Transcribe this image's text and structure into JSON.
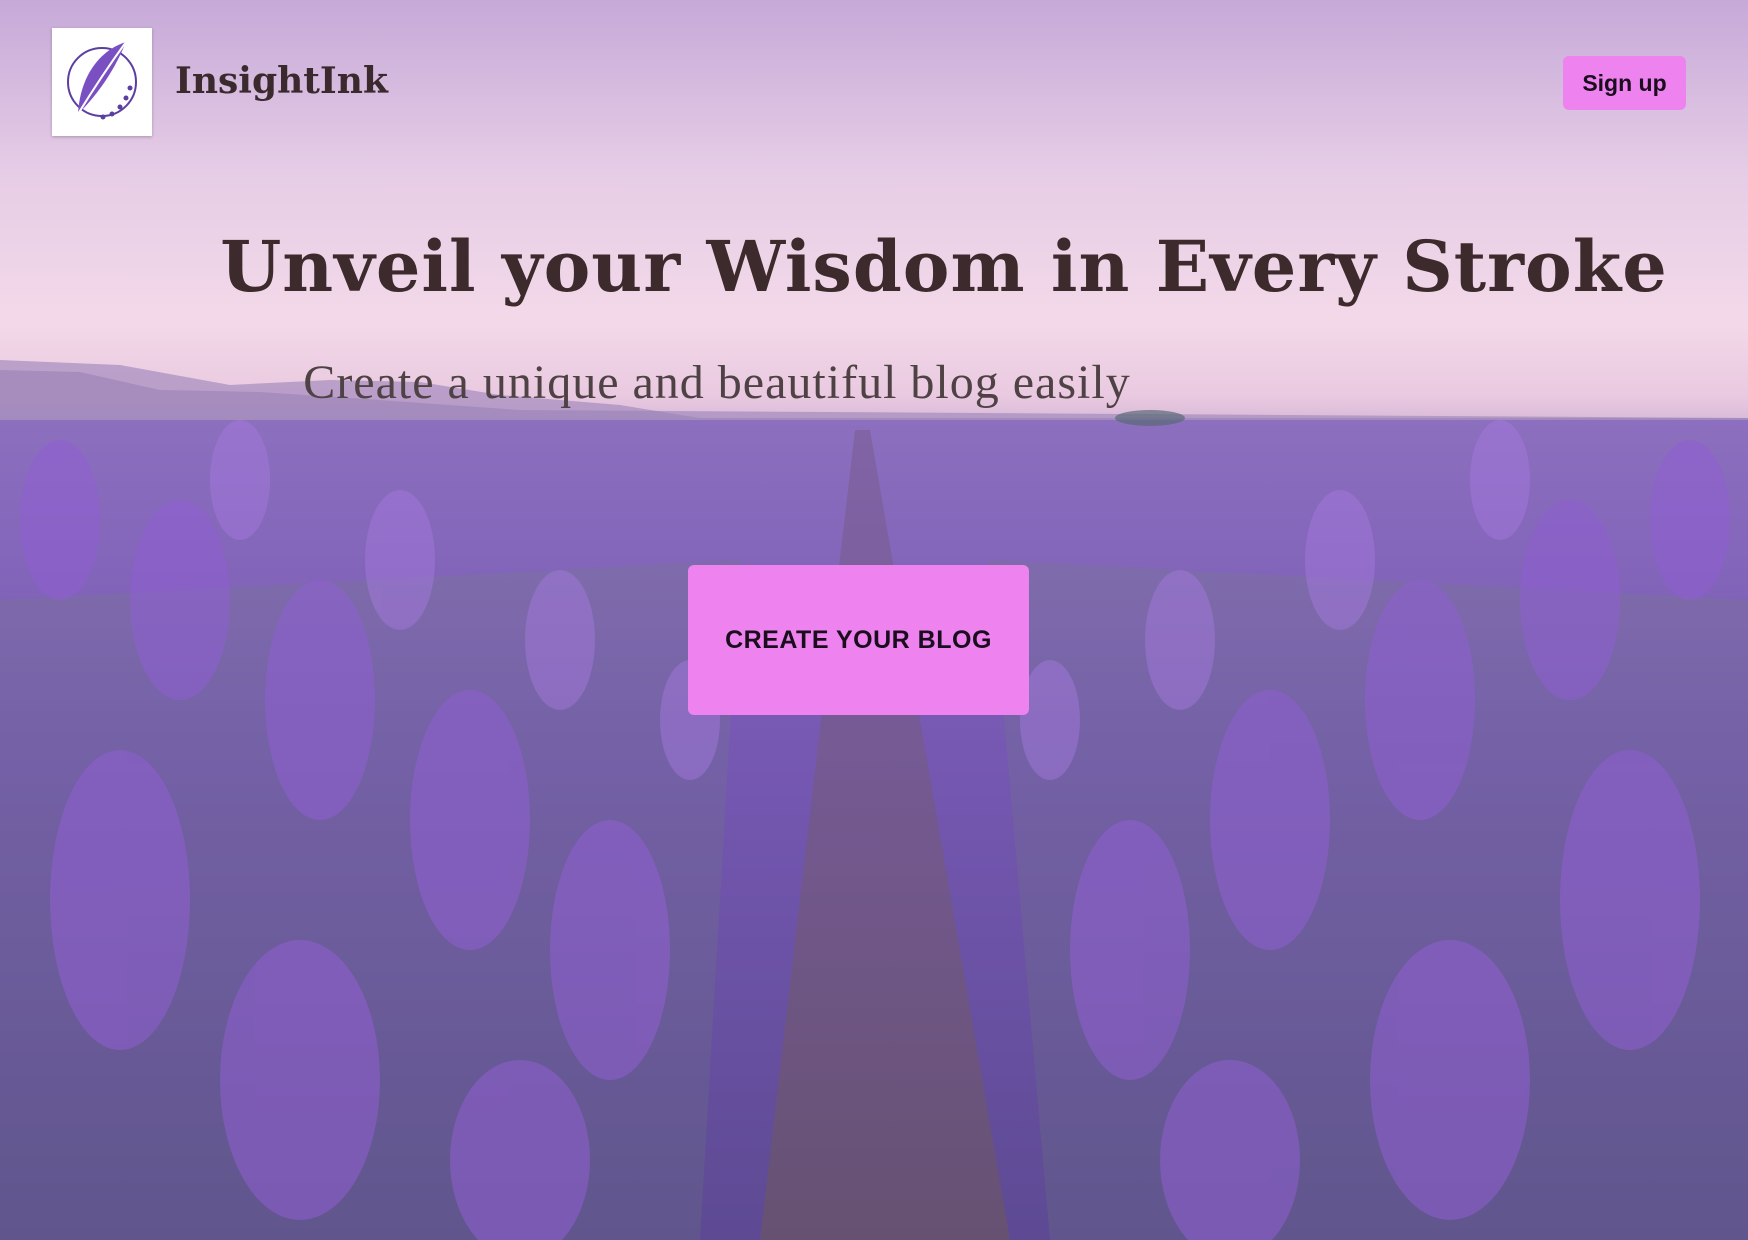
{
  "navbar": {
    "brand_name": "InsightInk",
    "signup_label": "Sign up"
  },
  "hero": {
    "headline": "Unveil your Wisdom in Every Stroke",
    "subheadline": "Create a unique and beautiful blog easily",
    "cta_label": "CREATE YOUR BLOG"
  },
  "theme": {
    "accent": "#ee82ee",
    "text_dark": "#3c2a2c",
    "lavender": "#7d5db4"
  },
  "icons": {
    "logo": "feather-quill-icon"
  }
}
